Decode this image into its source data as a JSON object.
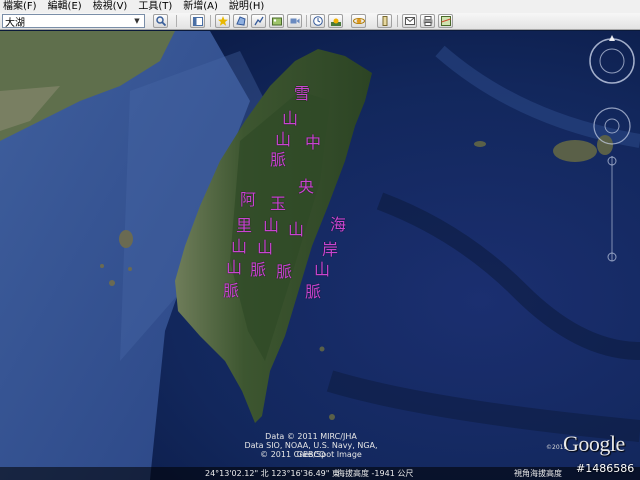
{
  "menu": {
    "file": "檔案(F)",
    "edit": "編輯(E)",
    "view": "檢視(V)",
    "tools": "工具(T)",
    "add": "新增(A)",
    "help": "說明(H)"
  },
  "search": {
    "value": "大湖"
  },
  "toolbar_icons": [
    "search-icon",
    "sidebar-icon",
    "placemark-icon",
    "polygon-icon",
    "path-icon",
    "image-overlay-icon",
    "record-tour-icon",
    "historical-imagery-icon",
    "sunlight-icon",
    "switch-to-sky-icon",
    "ruler-icon",
    "email-icon",
    "print-icon",
    "view-in-maps-icon"
  ],
  "map_labels": {
    "xueshan": "雪山山脈",
    "central": "中央山脈",
    "yushan": "玉山山脈",
    "alishan": "阿里山山脈",
    "coastal": "海岸山脈"
  },
  "attribution": {
    "line1": "Data © 2011 MIRC/JHA",
    "line2": "Data SIO, NOAA, U.S. Navy, NGA, GEBCO",
    "line3": "© 2011 Cnes/Spot Image"
  },
  "logo": {
    "text": "Google",
    "year": "©2011"
  },
  "status": {
    "coordinates": "24°13'02.12\" 北  123°16'36.49\" 東",
    "altitude": "海拔高度 -1941 公尺",
    "eye_altitude": "視角海拔高度"
  },
  "watermark": "#1486586",
  "colors": {
    "label": "#c845d0",
    "ocean_deep": "#0b1e52",
    "ocean_shallow": "#3d5c9a",
    "land": "#3f5a2f"
  }
}
